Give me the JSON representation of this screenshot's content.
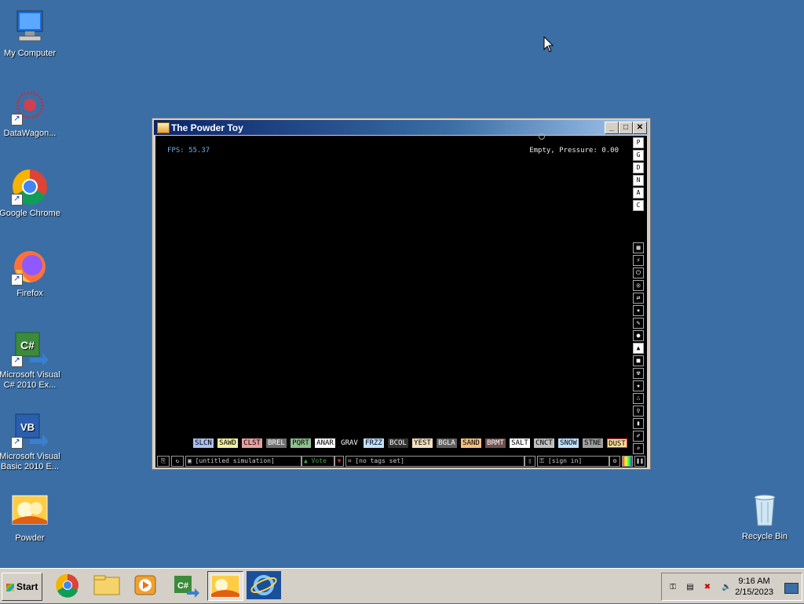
{
  "desktop": {
    "icons": [
      {
        "label": "My Computer"
      },
      {
        "label": "DataWagon..."
      },
      {
        "label": "Google Chrome"
      },
      {
        "label": "Firefox"
      },
      {
        "label": "Microsoft Visual C# 2010 Ex..."
      },
      {
        "label": "Microsoft Visual Basic 2010 E..."
      },
      {
        "label": "Powder"
      },
      {
        "label": "Recycle Bin"
      }
    ]
  },
  "window": {
    "title": "The Powder Toy",
    "min_label": "_",
    "max_label": "□",
    "close_label": "✕"
  },
  "sim": {
    "fps": "FPS: 55.37",
    "status": "Empty, Pressure: 0.00",
    "side_letters": [
      "P",
      "G",
      "D",
      "N",
      "A",
      "C"
    ],
    "elements": [
      {
        "label": "SLCN",
        "bg": "#a9c1ef"
      },
      {
        "label": "SAWD",
        "bg": "#f0f0a0"
      },
      {
        "label": "CLST",
        "bg": "#e8a0a0"
      },
      {
        "label": "BREL",
        "bg": "#707070"
      },
      {
        "label": "PQRT",
        "bg": "#90c090"
      },
      {
        "label": "ANAR",
        "bg": "#ffffff"
      },
      {
        "label": "GRAV",
        "bg": "#000000"
      },
      {
        "label": "FRZZ",
        "bg": "#c0e0ff"
      },
      {
        "label": "BCOL",
        "bg": "#333333"
      },
      {
        "label": "YEST",
        "bg": "#f0e0c0"
      },
      {
        "label": "BGLA",
        "bg": "#606060"
      },
      {
        "label": "SAND",
        "bg": "#f0c080"
      },
      {
        "label": "BRMT",
        "bg": "#705050"
      },
      {
        "label": "SALT",
        "bg": "#ffffff"
      },
      {
        "label": "CNCT",
        "bg": "#c0c0c0"
      },
      {
        "label": "SNOW",
        "bg": "#c0e0ff"
      },
      {
        "label": "STNE",
        "bg": "#a0a0a0"
      },
      {
        "label": "DUST",
        "bg": "#ffe0a0"
      }
    ],
    "bottom": {
      "simulation_name": "[untitled simulation]",
      "vote": "Vote",
      "tags": "[no tags set]",
      "sign_in": "[sign in]"
    }
  },
  "taskbar": {
    "start_label": "Start",
    "time": "9:16 AM",
    "date": "2/15/2023"
  }
}
